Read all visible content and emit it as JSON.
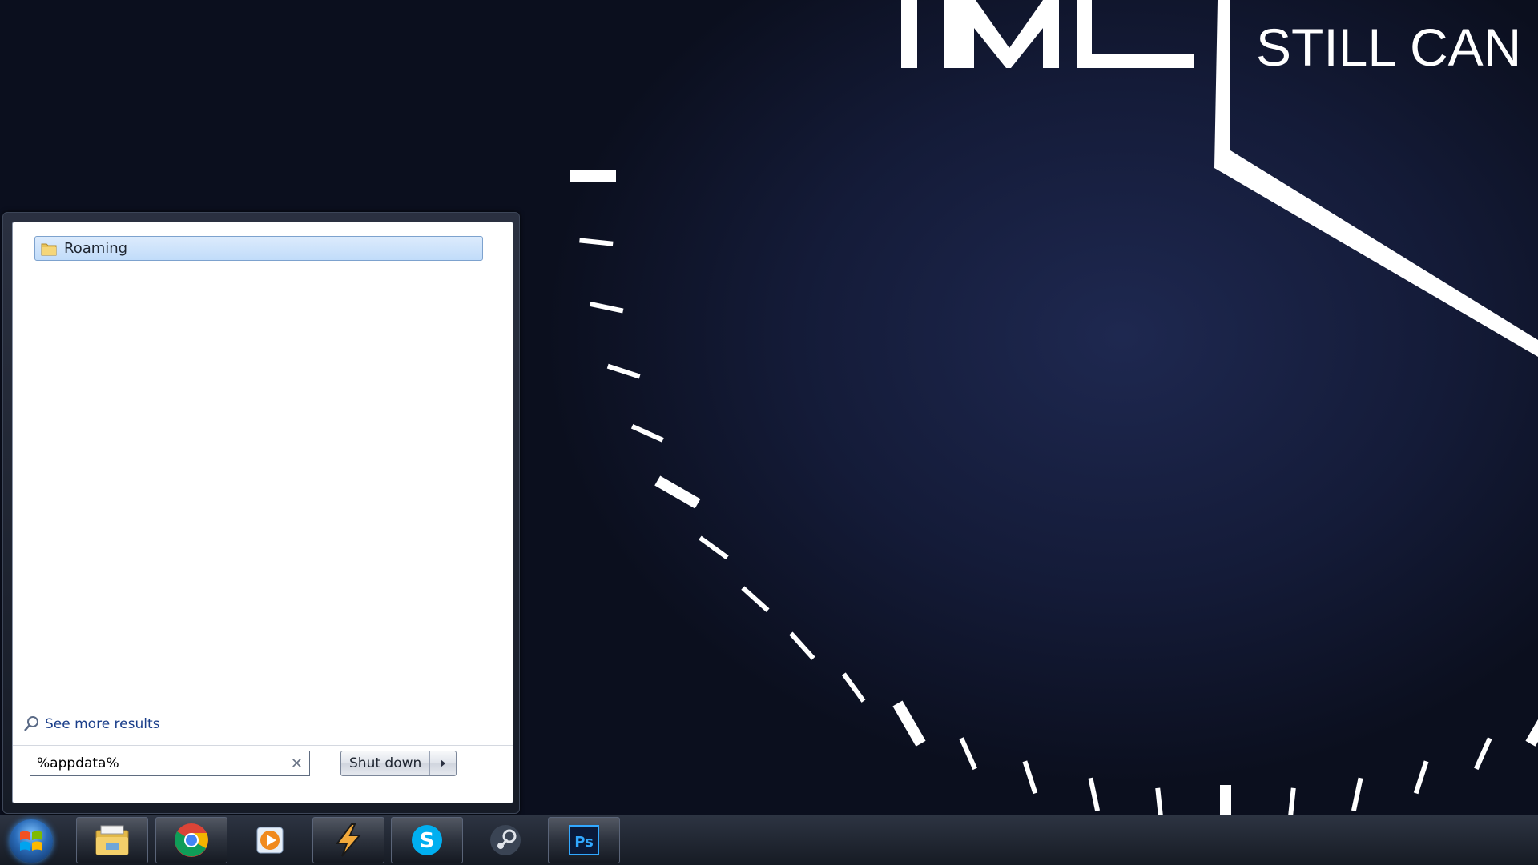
{
  "wallpaper": {
    "text": "STILL CAN",
    "colors": {
      "background": "#141b38",
      "marks": "#ffffff"
    }
  },
  "start_menu": {
    "results": [
      {
        "label": "Roaming",
        "icon": "folder-icon"
      }
    ],
    "see_more": "See more results",
    "search": {
      "value": "%appdata%",
      "clear_icon": "close-icon"
    },
    "shutdown": {
      "label": "Shut down",
      "arrow_icon": "chevron-right-icon"
    }
  },
  "taskbar": {
    "start_icon": "windows-logo-icon",
    "items": [
      {
        "name": "file-explorer",
        "icon": "folder-library-icon",
        "pinned_style": "button"
      },
      {
        "name": "chrome",
        "icon": "chrome-icon",
        "pinned_style": "button"
      },
      {
        "name": "media-player",
        "icon": "play-icon",
        "pinned_style": "plain"
      },
      {
        "name": "winamp",
        "icon": "lightning-icon",
        "pinned_style": "button"
      },
      {
        "name": "skype",
        "icon": "skype-icon",
        "pinned_style": "button"
      },
      {
        "name": "steam",
        "icon": "steam-icon",
        "pinned_style": "plain"
      },
      {
        "name": "photoshop",
        "icon": "photoshop-icon",
        "pinned_style": "button",
        "label": "Ps"
      }
    ]
  }
}
